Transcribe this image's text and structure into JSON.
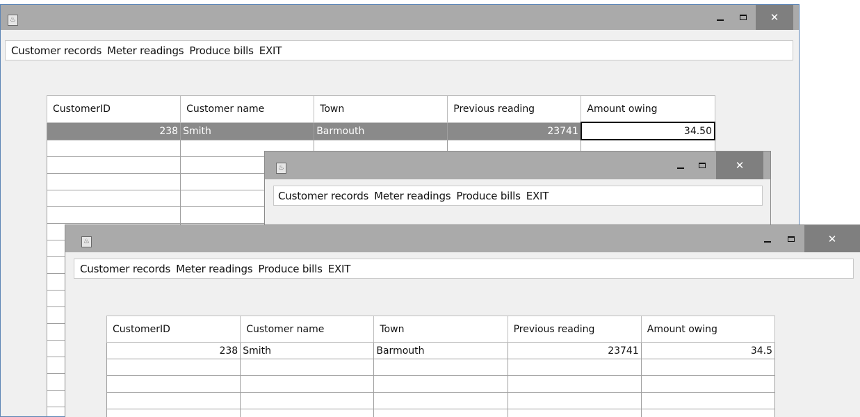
{
  "window_back": {
    "menu": [
      "Customer records",
      "Meter readings",
      "Produce bills",
      "EXIT"
    ],
    "table": {
      "headers": [
        "CustomerID",
        "Customer name",
        "Town",
        "Previous reading",
        "Amount owing"
      ],
      "rows": [
        [
          "238",
          "Smith",
          "Barmouth",
          "23741",
          "34.50"
        ],
        [
          "",
          "",
          "",
          "",
          ""
        ],
        [
          "",
          "",
          "",
          "",
          ""
        ],
        [
          "",
          "",
          "",
          "",
          ""
        ],
        [
          "",
          "",
          "",
          "",
          ""
        ],
        [
          "",
          "",
          "",
          "",
          ""
        ],
        [
          "",
          "",
          "",
          "",
          ""
        ],
        [
          "",
          "",
          "",
          "",
          ""
        ],
        [
          "",
          "",
          "",
          "",
          ""
        ],
        [
          "",
          "",
          "",
          "",
          ""
        ],
        [
          "",
          "",
          "",
          "",
          ""
        ],
        [
          "",
          "",
          "",
          "",
          ""
        ],
        [
          "",
          "",
          "",
          "",
          ""
        ],
        [
          "",
          "",
          "",
          "",
          ""
        ],
        [
          "",
          "",
          "",
          "",
          ""
        ],
        [
          "",
          "",
          "",
          "",
          ""
        ],
        [
          "",
          "",
          "",
          "",
          ""
        ],
        [
          "",
          "",
          "",
          "",
          ""
        ]
      ]
    }
  },
  "window_middle": {
    "menu": [
      "Customer records",
      "Meter readings",
      "Produce bills",
      "EXIT"
    ]
  },
  "window_front": {
    "menu": [
      "Customer records",
      "Meter readings",
      "Produce bills",
      "EXIT"
    ],
    "table": {
      "headers": [
        "CustomerID",
        "Customer name",
        "Town",
        "Previous reading",
        "Amount owing"
      ],
      "rows": [
        [
          "238",
          "Smith",
          "Barmouth",
          "23741",
          "34.5"
        ],
        [
          "",
          "",
          "",
          "",
          ""
        ],
        [
          "",
          "",
          "",
          "",
          ""
        ],
        [
          "",
          "",
          "",
          "",
          ""
        ],
        [
          "",
          "",
          "",
          "",
          ""
        ]
      ]
    }
  },
  "controls": {
    "minimize_glyph": "_",
    "maximize_glyph": "□",
    "close_glyph": "✕"
  },
  "colors": {
    "titlebar": "#aaaaaa",
    "close_button": "#7f7f7f",
    "selected_row": "#8a8a8a",
    "window_bg": "#f0f0f0"
  }
}
